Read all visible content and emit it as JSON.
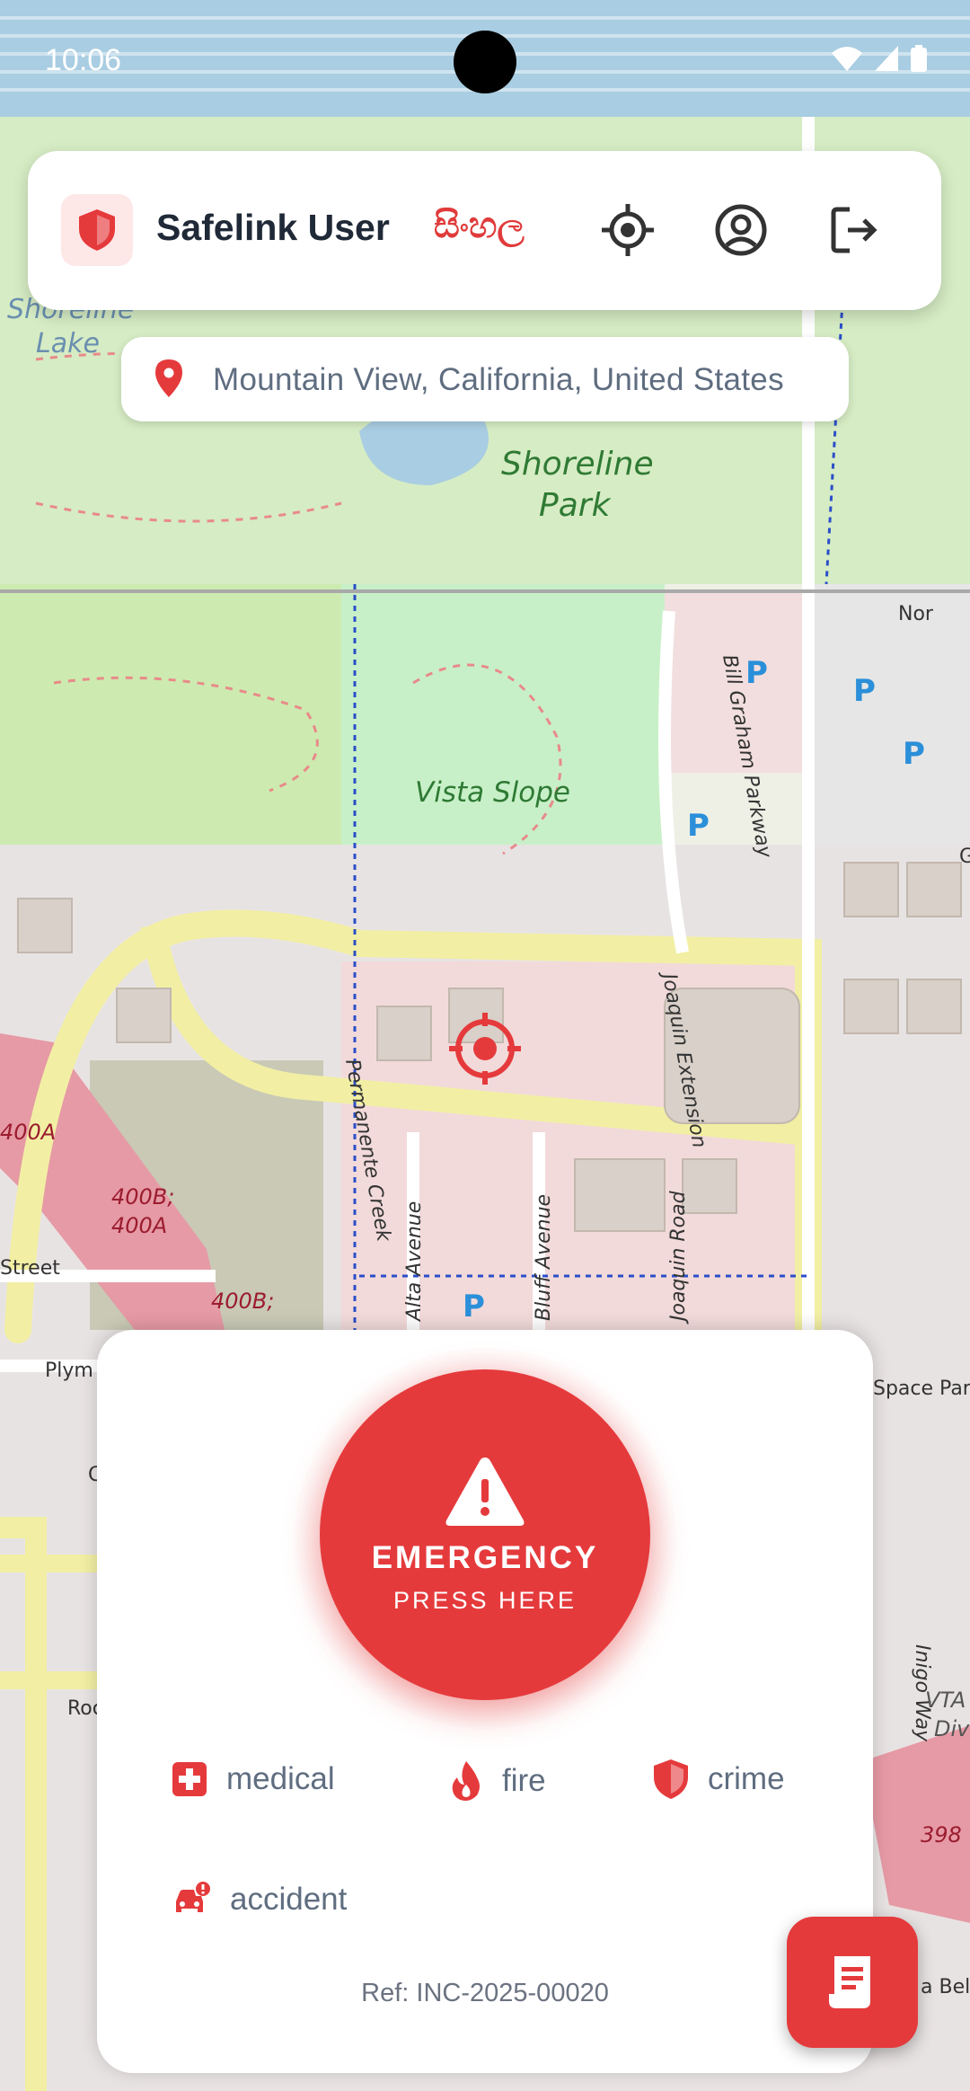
{
  "status_bar": {
    "time": "10:06"
  },
  "header": {
    "title": "Safelink User",
    "language_label": "සිංහල",
    "logo_icon": "shield-icon",
    "actions": [
      "my-location-icon",
      "profile-icon",
      "logout-icon"
    ]
  },
  "location": {
    "text": "Mountain View, California, United States"
  },
  "map": {
    "labels": {
      "shoreline_lake_1": "Shoreline",
      "shoreline_lake_2": "Lake",
      "shoreline_park_1": "Shoreline",
      "shoreline_park_2": "Park",
      "vista_slope": "Vista Slope",
      "bill_graham": "Bill Graham Parkway",
      "joaquin": "Joaquin Extension",
      "permanente": "Permanente Creek",
      "alta": "Alta Avenue",
      "bluff": "Bluff Avenue",
      "joaquin_road": "Joaquin Road",
      "exit_400a": "400A",
      "exit_400b_1": "400B;",
      "exit_400b_2": "400A",
      "exit_400b_3": "400B;",
      "street": "Street",
      "plymouth": "Plym",
      "space_park": "Space Park",
      "inigo": "Inigo Way",
      "vta": "VTA",
      "div": "Div",
      "exit_398": "398",
      "bella": "a Bell",
      "north": "Nor",
      "roc": "Roc",
      "c": "C",
      "g": "G"
    },
    "parking_label": "P"
  },
  "emergency": {
    "title": "EMERGENCY",
    "subtitle": "PRESS HERE",
    "icon": "warning-icon",
    "categories": [
      {
        "label": "medical",
        "icon": "medical-cross-icon"
      },
      {
        "label": "fire",
        "icon": "fire-icon"
      },
      {
        "label": "crime",
        "icon": "shield-icon"
      },
      {
        "label": "accident",
        "icon": "car-alert-icon"
      }
    ],
    "reference": "Ref: INC-2025-00020"
  },
  "fab": {
    "icon": "receipt-icon"
  },
  "colors": {
    "accent": "#e53a3c",
    "text_muted": "#5f6d80",
    "title": "#1f2937"
  }
}
